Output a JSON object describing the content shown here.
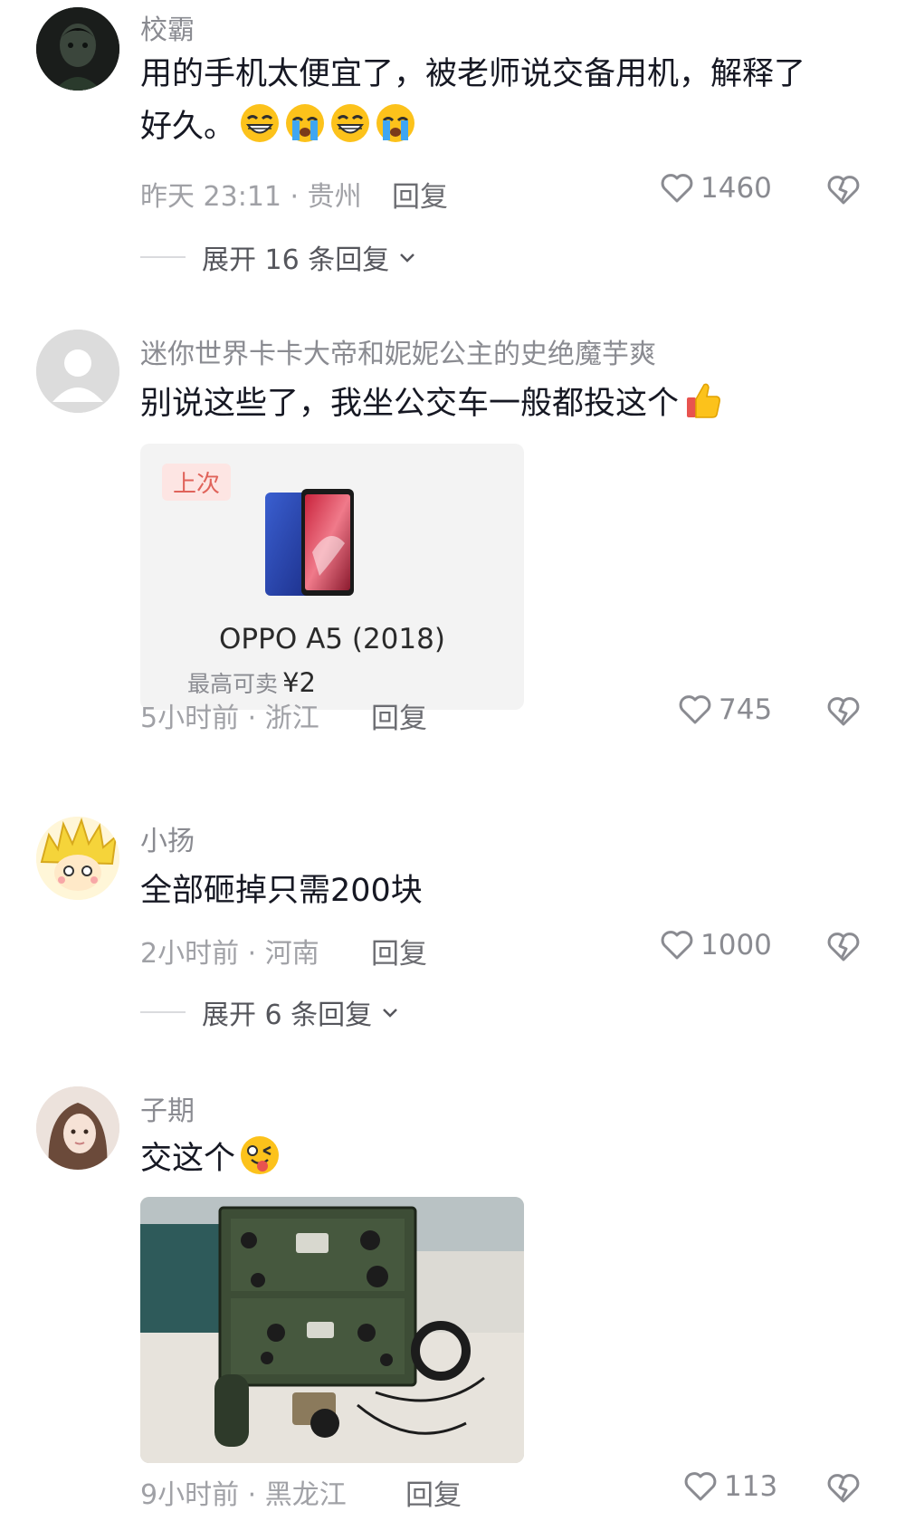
{
  "comments": [
    {
      "username": "校霸",
      "text_line1": "用的手机太便宜了，被老师说交备用机，解释了",
      "text_line2": "好久。",
      "emojis": [
        "grin-emoji",
        "crying-emoji",
        "grin-emoji",
        "crying-emoji"
      ],
      "time_location": "昨天 23:11 · 贵州",
      "reply_label": "回复",
      "likes": "1460",
      "expand_label": "展开 16 条回复"
    },
    {
      "username": "迷你世界卡卡大帝和妮妮公主的史绝魔芋爽",
      "text": "别说这些了，我坐公交车一般都投这个",
      "emojis": [
        "thumbs-up-emoji"
      ],
      "card": {
        "tag": "上次",
        "product_name": "OPPO A5 (2018)",
        "price_label": "最高可卖",
        "price": "¥2"
      },
      "time_location": "5小时前 · 浙江",
      "reply_label": "回复",
      "likes": "745"
    },
    {
      "username": "小扬",
      "text": "全部砸掉只需200块",
      "time_location": "2小时前 · 河南",
      "reply_label": "回复",
      "likes": "1000",
      "expand_label": "展开 6 条回复"
    },
    {
      "username": "子期",
      "text": "交这个",
      "emojis": [
        "tongue-out-emoji"
      ],
      "image": "military-radio-photo",
      "time_location": "9小时前 · 黑龙江",
      "reply_label": "回复",
      "likes": "113"
    }
  ],
  "icons": {
    "like": "heart-outline-icon",
    "dislike": "broken-heart-icon",
    "expand": "chevron-down-icon"
  },
  "colors": {
    "text_primary": "#161823",
    "text_secondary": "#8a8b91",
    "tag_bg": "#fde5e3",
    "tag_text": "#e0635a"
  }
}
